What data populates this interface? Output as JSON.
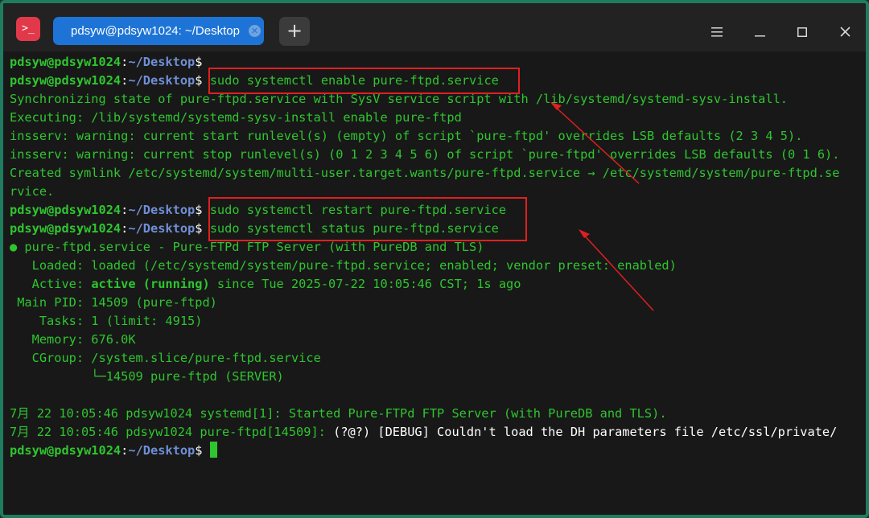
{
  "titlebar": {
    "app_icon": ">_",
    "tab_title": "pdsyw@pdsyw1024: ~/Desktop",
    "new_tab_label": "+",
    "menu_icon": "hamburger-menu-icon",
    "minimize_icon": "minimize-icon",
    "maximize_icon": "maximize-icon",
    "close_icon": "close-icon"
  },
  "prompt": {
    "user": "pdsyw@pdsyw1024",
    "sep": ":",
    "path": "~/Desktop",
    "dollar": "$"
  },
  "terminal": {
    "cmd1": "sudo systemctl enable pure-ftpd.service",
    "out1": "Synchronizing state of pure-ftpd.service with SysV service script with /lib/systemd/systemd-sysv-install.",
    "out2": "Executing: /lib/systemd/systemd-sysv-install enable pure-ftpd",
    "out3": "insserv: warning: current start runlevel(s) (empty) of script `pure-ftpd' overrides LSB defaults (2 3 4 5).",
    "out4": "insserv: warning: current stop runlevel(s) (0 1 2 3 4 5 6) of script `pure-ftpd' overrides LSB defaults (0 1 6).",
    "out5": "Created symlink /etc/systemd/system/multi-user.target.wants/pure-ftpd.service → /etc/systemd/system/pure-ftpd.se",
    "out6": "rvice.",
    "cmd2": "sudo systemctl restart pure-ftpd.service",
    "cmd3": "sudo systemctl status pure-ftpd.service",
    "status_head": "● pure-ftpd.service - Pure-FTPd FTP Server (with PureDB and TLS)",
    "loaded": "   Loaded: loaded (/etc/systemd/system/pure-ftpd.service; enabled; vendor preset: enabled)",
    "active_label": "   Active: ",
    "active_state": "active (running)",
    "active_rest": " since Tue 2025-07-22 10:05:46 CST; 1s ago",
    "main_pid": " Main PID: 14509 (pure-ftpd)",
    "tasks": "    Tasks: 1 (limit: 4915)",
    "memory": "   Memory: 676.0K",
    "cgroup": "   CGroup: /system.slice/pure-ftpd.service",
    "cgroup_child": "           └─14509 pure-ftpd (SERVER)",
    "log1": "7月 22 10:05:46 pdsyw1024 systemd[1]: Started Pure-FTPd FTP Server (with PureDB and TLS).",
    "log2_prefix": "7月 22 10:05:46 pdsyw1024 pure-ftpd[14509]: ",
    "log2_msg": "(?@?) [DEBUG] Couldn't load the DH parameters file /etc/ssl/private/"
  },
  "colors": {
    "accent": "#1e74d6",
    "terminal_green": "#2fc52f",
    "path_blue": "#6f8fd6",
    "annotation_red": "#e02020",
    "window_border": "#1e7d5e"
  }
}
